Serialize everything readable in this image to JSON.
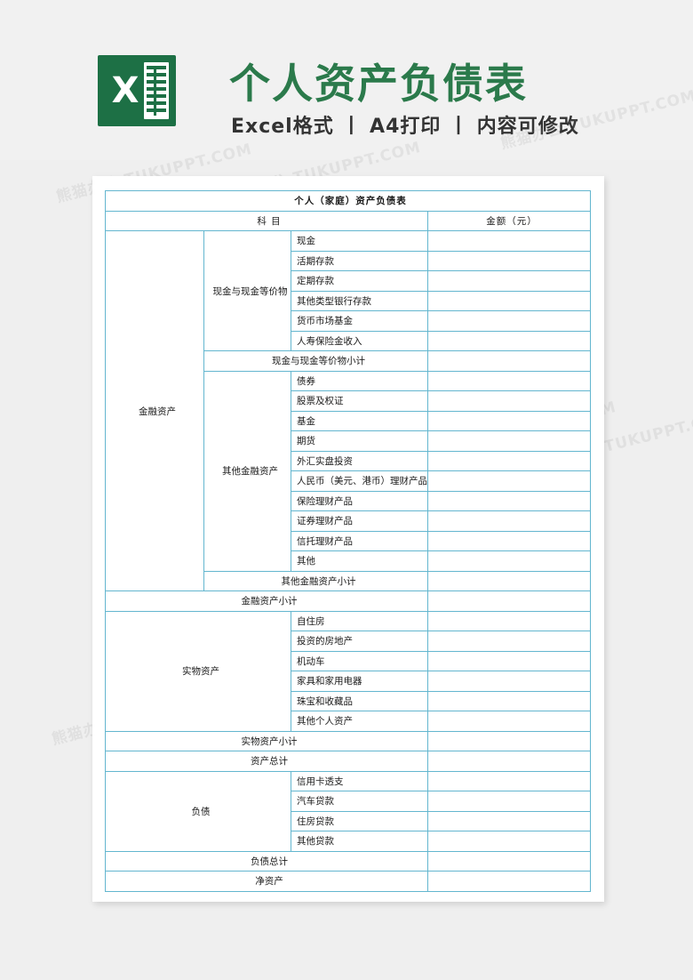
{
  "banner": {
    "logo_letter": "X",
    "headline": "个人资产负债表",
    "subline": "Excel格式 丨 A4打印 丨 内容可修改",
    "brand_green": "#2b7a4b",
    "logo_green": "#1d7045"
  },
  "watermarks": [
    "熊猫办公 TUKUPPT.COM",
    "熊猫办公 TUKUPPT.COM",
    "熊猫办公 TUKUPPT.COM",
    "熊猫办公 TUKUPPT.COM",
    "熊猫办公 TUKUPPT.COM",
    "熊猫办公 TUKUPPT.COM",
    "熊猫办公 TUKUPPT.COM",
    "熊猫办公 TUKUPPT.COM",
    "熊猫办公 TUKUPPT.COM"
  ],
  "table": {
    "accent": "#4bacc6",
    "border": "#63b6cf",
    "title": "个人（家庭）资产负债表",
    "headers": {
      "subject": "科  目",
      "amount": "金额（元）"
    },
    "groups": {
      "financial_assets": "金融资产",
      "physical_assets": "实物资产",
      "liabilities": "负债"
    },
    "subgroups": {
      "cash_equivalents": "现金与现金等价物",
      "other_financial": "其他金融资产"
    },
    "items": {
      "cash": "现金",
      "demand_deposit": "活期存款",
      "time_deposit": "定期存款",
      "other_bank_deposit": "其他类型银行存款",
      "money_market_fund": "货币市场基金",
      "life_insurance_income": "人寿保险金收入",
      "bond": "债券",
      "stock_warrant": "股票及权证",
      "fund": "基金",
      "futures": "期货",
      "forex_spot": "外汇实盘投资",
      "rmb_wealth_product": "人民币（美元、港币）理财产品",
      "insurance_wealth_product": "保险理财产品",
      "securities_wealth_product": "证券理财产品",
      "trust_wealth_product": "信托理财产品",
      "other": "其他",
      "own_house": "自住房",
      "investment_real_estate": "投资的房地产",
      "motor_vehicle": "机动车",
      "furniture_appliance": "家具和家用电器",
      "jewelry_collection": "珠宝和收藏品",
      "other_personal_asset": "其他个人资产",
      "credit_card_overdraft": "信用卡透支",
      "car_loan": "汽车贷款",
      "housing_loan": "住房贷款",
      "other_loan": "其他贷款"
    },
    "subtotals": {
      "cash_equivalents_subtotal": "现金与现金等价物小计",
      "other_financial_subtotal": "其他金融资产小计",
      "financial_assets_subtotal": "金融资产小计",
      "physical_assets_subtotal": "实物资产小计",
      "assets_total": "资产总计",
      "liabilities_total": "负债总计",
      "net_assets": "净资产"
    },
    "values": {
      "cash": "",
      "demand_deposit": "",
      "time_deposit": "",
      "other_bank_deposit": "",
      "money_market_fund": "",
      "life_insurance_income": "",
      "cash_equivalents_subtotal": "",
      "bond": "",
      "stock_warrant": "",
      "fund": "",
      "futures": "",
      "forex_spot": "",
      "rmb_wealth_product": "",
      "insurance_wealth_product": "",
      "securities_wealth_product": "",
      "trust_wealth_product": "",
      "other": "",
      "other_financial_subtotal": "",
      "financial_assets_subtotal": "",
      "own_house": "",
      "investment_real_estate": "",
      "motor_vehicle": "",
      "furniture_appliance": "",
      "jewelry_collection": "",
      "other_personal_asset": "",
      "physical_assets_subtotal": "",
      "assets_total": "",
      "credit_card_overdraft": "",
      "car_loan": "",
      "housing_loan": "",
      "other_loan": "",
      "liabilities_total": "",
      "net_assets": ""
    }
  }
}
